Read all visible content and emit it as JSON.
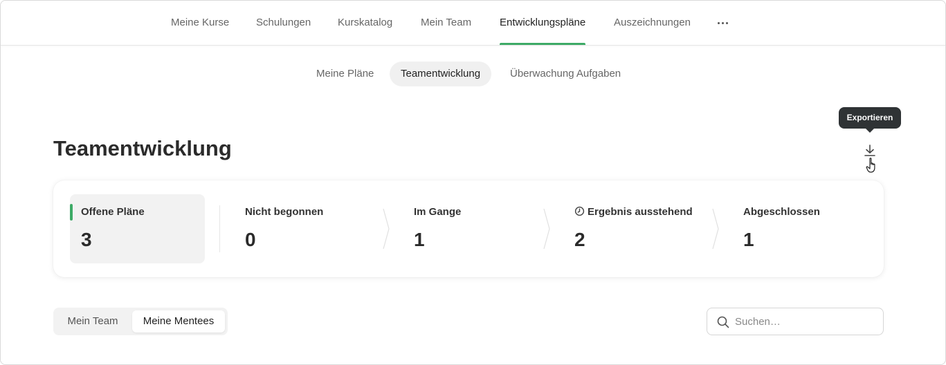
{
  "topnav": {
    "items": [
      {
        "label": "Meine Kurse"
      },
      {
        "label": "Schulungen"
      },
      {
        "label": "Kurskatalog"
      },
      {
        "label": "Mein Team"
      },
      {
        "label": "Entwicklungspläne",
        "active": true
      },
      {
        "label": "Auszeichnungen"
      }
    ],
    "more_icon": "more-horizontal-icon"
  },
  "subtabs": [
    {
      "label": "Meine Pläne"
    },
    {
      "label": "Teamentwicklung",
      "active": true
    },
    {
      "label": "Überwachung Aufgaben"
    }
  ],
  "page": {
    "title": "Teamentwicklung",
    "export_tooltip": "Exportieren",
    "export_icon": "download-icon"
  },
  "stats": [
    {
      "label": "Offene Pläne",
      "value": "3",
      "active": true
    },
    {
      "label": "Nicht begonnen",
      "value": "0"
    },
    {
      "label": "Im Gange",
      "value": "1"
    },
    {
      "label": "Ergebnis ausstehend",
      "value": "2",
      "icon": "clock-icon"
    },
    {
      "label": "Abgeschlossen",
      "value": "1"
    }
  ],
  "filter": {
    "segments": [
      {
        "label": "Mein Team"
      },
      {
        "label": "Meine Mentees",
        "active": true
      }
    ]
  },
  "search": {
    "placeholder": "Suchen…",
    "value": ""
  },
  "colors": {
    "accent": "#3daa66",
    "tooltip_bg": "#2f3335"
  }
}
